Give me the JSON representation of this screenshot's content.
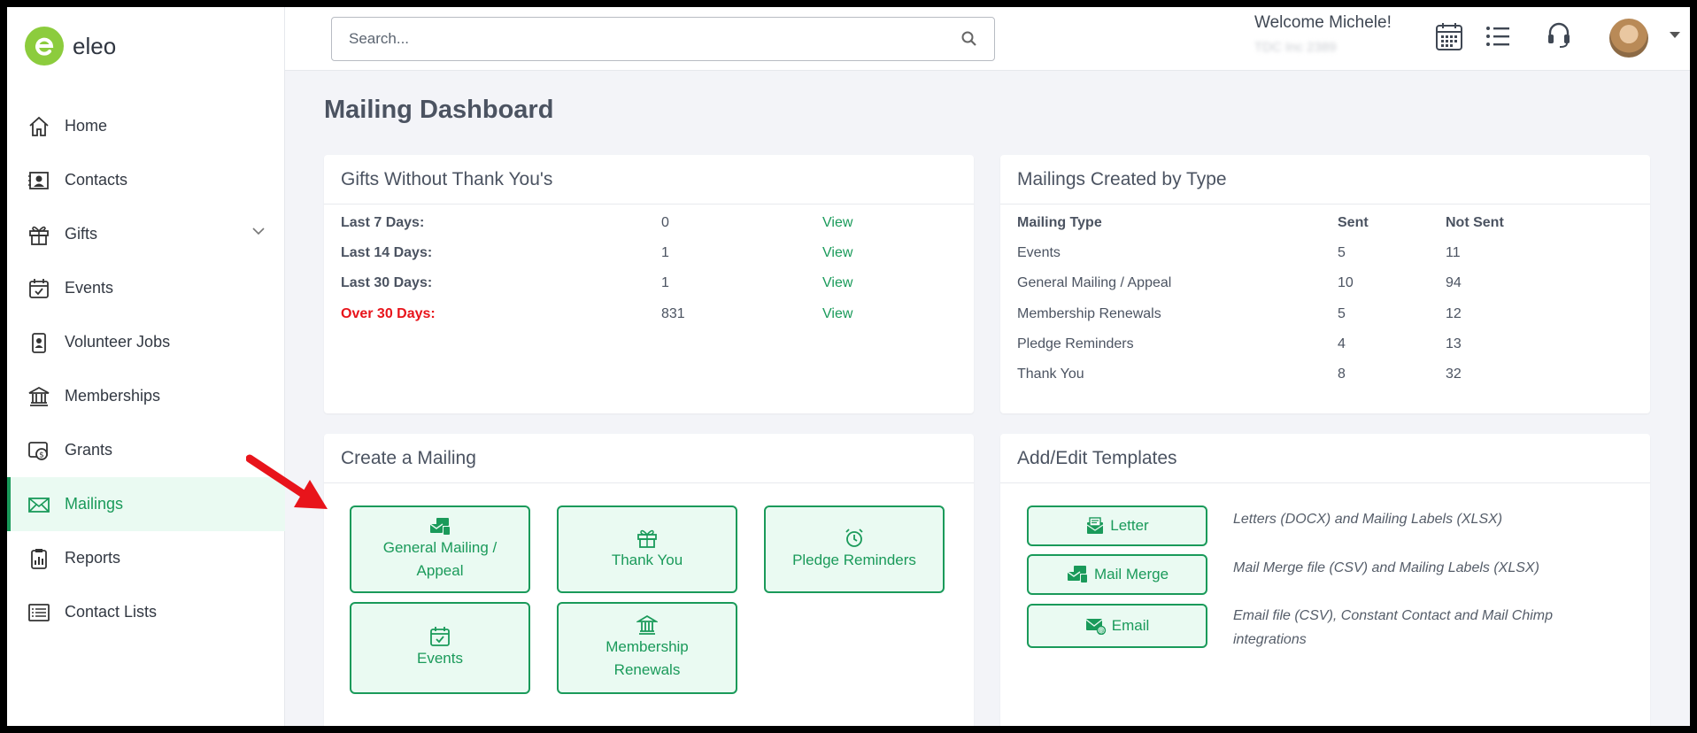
{
  "app": {
    "logo_text": "eleo"
  },
  "sidebar": {
    "items": [
      {
        "label": "Home",
        "icon": "home-icon"
      },
      {
        "label": "Contacts",
        "icon": "contacts-icon"
      },
      {
        "label": "Gifts",
        "icon": "gift-icon"
      },
      {
        "label": "Events",
        "icon": "calendar-check-icon"
      },
      {
        "label": "Volunteer Jobs",
        "icon": "badge-icon"
      },
      {
        "label": "Memberships",
        "icon": "institution-icon"
      },
      {
        "label": "Grants",
        "icon": "grants-icon"
      },
      {
        "label": "Mailings",
        "icon": "envelope-icon",
        "active": true
      },
      {
        "label": "Reports",
        "icon": "report-icon"
      },
      {
        "label": "Contact Lists",
        "icon": "list-icon"
      }
    ]
  },
  "header": {
    "search_placeholder": "Search...",
    "welcome": "Welcome Michele!",
    "subtext": "TDC Inc 2389"
  },
  "main": {
    "title": "Mailing Dashboard",
    "gifts_card": {
      "title": "Gifts Without Thank You's",
      "rows": [
        {
          "label": "Last 7 Days:",
          "count": "0",
          "action": "View"
        },
        {
          "label": "Last 14 Days:",
          "count": "1",
          "action": "View"
        },
        {
          "label": "Last 30 Days:",
          "count": "1",
          "action": "View"
        },
        {
          "label": "Over 30 Days:",
          "count": "831",
          "action": "View"
        }
      ]
    },
    "types_card": {
      "title": "Mailings Created by Type",
      "headers": [
        "Mailing Type",
        "Sent",
        "Not Sent"
      ],
      "rows": [
        {
          "type": "Events",
          "sent": "5",
          "not_sent": "11"
        },
        {
          "type": "General Mailing / Appeal",
          "sent": "10",
          "not_sent": "94"
        },
        {
          "type": "Membership Renewals",
          "sent": "5",
          "not_sent": "12"
        },
        {
          "type": "Pledge Reminders",
          "sent": "4",
          "not_sent": "13"
        },
        {
          "type": "Thank You",
          "sent": "8",
          "not_sent": "32"
        }
      ]
    },
    "create_card": {
      "title": "Create a Mailing",
      "buttons": [
        {
          "line1": "General Mailing /",
          "line2": "Appeal"
        },
        {
          "line1": "Thank You"
        },
        {
          "line1": "Pledge Reminders"
        },
        {
          "line1": "Events"
        },
        {
          "line1": "Membership",
          "line2": "Renewals"
        }
      ]
    },
    "templates_card": {
      "title": "Add/Edit Templates",
      "items": [
        {
          "label": "Letter",
          "desc": "Letters (DOCX) and Mailing Labels (XLSX)"
        },
        {
          "label": "Mail Merge",
          "desc": "Mail Merge file (CSV) and Mailing Labels (XLSX)"
        },
        {
          "label": "Email",
          "desc": "Email file (CSV), Constant Contact and Mail Chimp integrations"
        }
      ]
    }
  },
  "colors": {
    "accent": "#1a9a5a",
    "accent_bg": "#eafaf2",
    "alert": "#e8141b",
    "logo": "#8ccc3d"
  }
}
